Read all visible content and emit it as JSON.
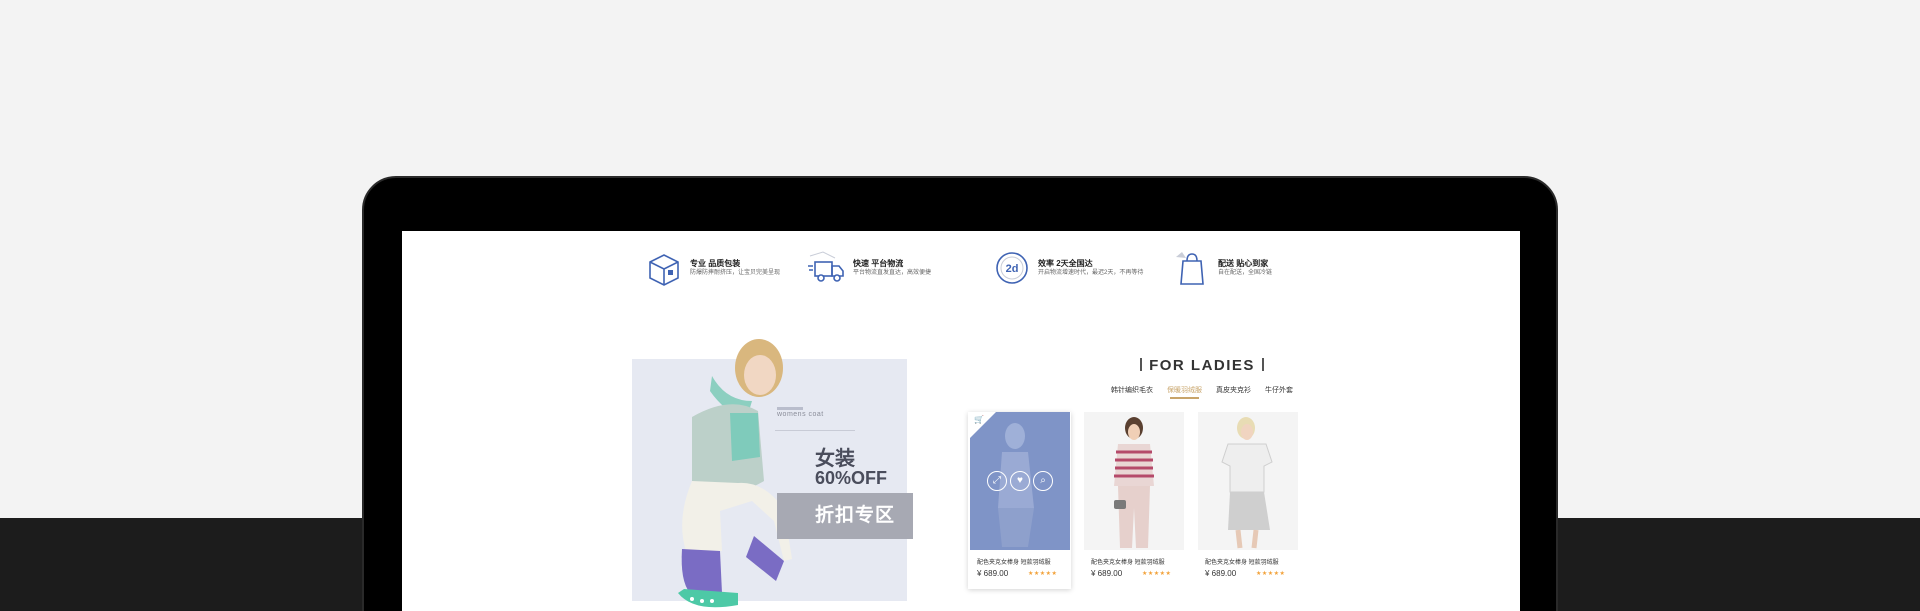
{
  "features": [
    {
      "title": "专业 品质包装",
      "sub": "防爆防摔耐挤压，让宝贝完美呈现",
      "icon": "package-box-icon"
    },
    {
      "title": "快速 平台物流",
      "sub": "平台物流直发直达，高效便捷",
      "icon": "delivery-truck-icon"
    },
    {
      "title": "效率 2天全国达",
      "sub": "开启物流增速时代，最迟2天，不再等待",
      "icon": "two-day-clock-icon"
    },
    {
      "title": "配送 贴心到家",
      "sub": "自在配送，全国冷链",
      "icon": "shopping-bag-icon"
    }
  ],
  "promo": {
    "sub": "womens coat",
    "title": "女装",
    "discount": "60%OFF",
    "button": "折扣专区"
  },
  "ladies": {
    "heading": "FOR LADIES",
    "tabs": [
      "韩针编织毛衣",
      "保暖羽绒服",
      "真皮夹克衫",
      "牛仔外套"
    ],
    "active_tab": 1,
    "products": [
      {
        "name": "配色夹克女棒身 短款羽绒服",
        "price": "¥ 689.00",
        "stars": "★★★★★"
      },
      {
        "name": "配色夹克女棒身 短款羽绒服",
        "price": "¥ 689.00",
        "stars": "★★★★★"
      },
      {
        "name": "配色夹克女棒身 短款羽绒服",
        "price": "¥ 689.00",
        "stars": "★★★★★"
      }
    ]
  },
  "colors": {
    "accent": "#c8a46a",
    "star": "#f2a23a",
    "promo_bg": "#e6e9f2",
    "featured_overlay": "#7f94c7"
  }
}
